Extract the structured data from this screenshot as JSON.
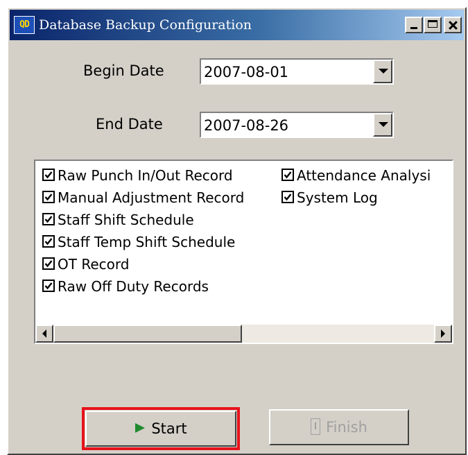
{
  "window": {
    "title": "Database Backup Configuration",
    "app_icon_text": "QD"
  },
  "form": {
    "begin_date_label": "Begin Date",
    "begin_date_value": "2007-08-01",
    "end_date_label": "End Date",
    "end_date_value": "2007-08-26"
  },
  "backup_items": {
    "column1": [
      {
        "label": "Raw Punch In/Out Record",
        "checked": true
      },
      {
        "label": "Manual Adjustment Record",
        "checked": true
      },
      {
        "label": "Staff Shift Schedule",
        "checked": true
      },
      {
        "label": "Staff Temp Shift Schedule",
        "checked": true
      },
      {
        "label": "OT Record",
        "checked": true
      },
      {
        "label": "Raw Off Duty Records",
        "checked": true
      }
    ],
    "column2": [
      {
        "label": "Attendance Analysi",
        "checked": true
      },
      {
        "label": "System Log",
        "checked": true
      }
    ]
  },
  "buttons": {
    "start_label": "Start",
    "finish_label": "Finish",
    "finish_enabled": false
  },
  "colors": {
    "titlebar_start": "#0a246a",
    "titlebar_end": "#a6caf0",
    "dialog_face": "#d4d0c8",
    "highlight": "#e8121b",
    "play_icon": "#1f8a2e"
  },
  "icons": [
    "app-icon",
    "minimize-icon",
    "maximize-icon",
    "close-icon",
    "dropdown-arrow-icon",
    "checkmark-icon",
    "play-icon",
    "finish-icon",
    "scroll-left-icon",
    "scroll-right-icon"
  ]
}
